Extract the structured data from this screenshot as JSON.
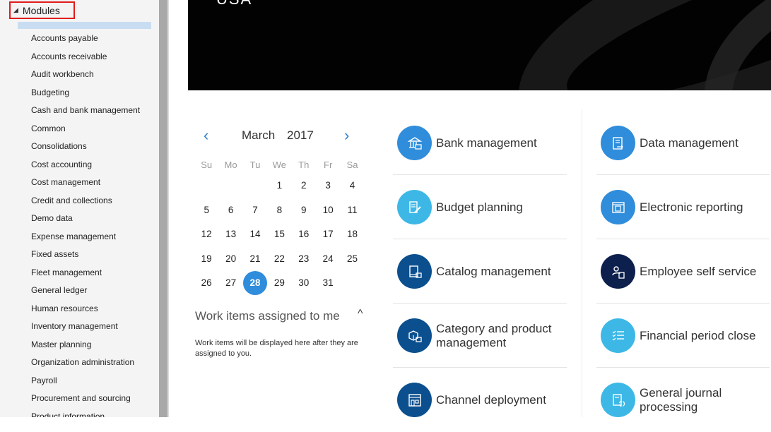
{
  "sidebar": {
    "header": "Modules",
    "header_icon": "collapse-triangle-icon",
    "items": [
      "Accounts payable",
      "Accounts receivable",
      "Audit workbench",
      "Budgeting",
      "Cash and bank management",
      "Common",
      "Consolidations",
      "Cost accounting",
      "Cost management",
      "Credit and collections",
      "Demo data",
      "Expense management",
      "Fixed assets",
      "Fleet management",
      "General ledger",
      "Human resources",
      "Inventory management",
      "Master planning",
      "Organization administration",
      "Payroll",
      "Procurement and sourcing",
      "Product information"
    ]
  },
  "banner": {
    "title": "USA"
  },
  "calendar": {
    "prev_icon": "‹",
    "next_icon": "›",
    "month": "March",
    "year": "2017",
    "weekdays": [
      "Su",
      "Mo",
      "Tu",
      "We",
      "Th",
      "Fr",
      "Sa"
    ],
    "days": [
      "",
      "",
      "",
      "1",
      "2",
      "3",
      "4",
      "5",
      "6",
      "7",
      "8",
      "9",
      "10",
      "11",
      "12",
      "13",
      "14",
      "15",
      "16",
      "17",
      "18",
      "19",
      "20",
      "21",
      "22",
      "23",
      "24",
      "25",
      "26",
      "27",
      "28",
      "29",
      "30",
      "31",
      ""
    ],
    "selected_day": "28"
  },
  "work_items": {
    "title": "Work items assigned to me",
    "chevron": "^",
    "message": "Work items will be displayed here after they are assigned to you."
  },
  "tiles": {
    "left": [
      {
        "label": "Bank management",
        "icon": "bank-icon",
        "color": "#2f8ddb"
      },
      {
        "label": "Budget planning",
        "icon": "budget-pencil-icon",
        "color": "#3db8e6"
      },
      {
        "label": "Catalog management",
        "icon": "catalog-icon",
        "color": "#0b4f8e"
      },
      {
        "label": "Category and product management",
        "icon": "product-box-icon",
        "color": "#0b4f8e"
      },
      {
        "label": "Channel deployment",
        "icon": "store-icon",
        "color": "#0b4f8e"
      }
    ],
    "right": [
      {
        "label": "Data management",
        "icon": "data-doc-icon",
        "color": "#2f8ddb"
      },
      {
        "label": "Electronic reporting",
        "icon": "report-window-icon",
        "color": "#2f8ddb"
      },
      {
        "label": "Employee self service",
        "icon": "person-doc-icon",
        "color": "#0d1f4c"
      },
      {
        "label": "Financial period close",
        "icon": "checklist-icon",
        "color": "#3db8e6"
      },
      {
        "label": "General journal processing",
        "icon": "journal-cycle-icon",
        "color": "#3db8e6"
      }
    ]
  }
}
